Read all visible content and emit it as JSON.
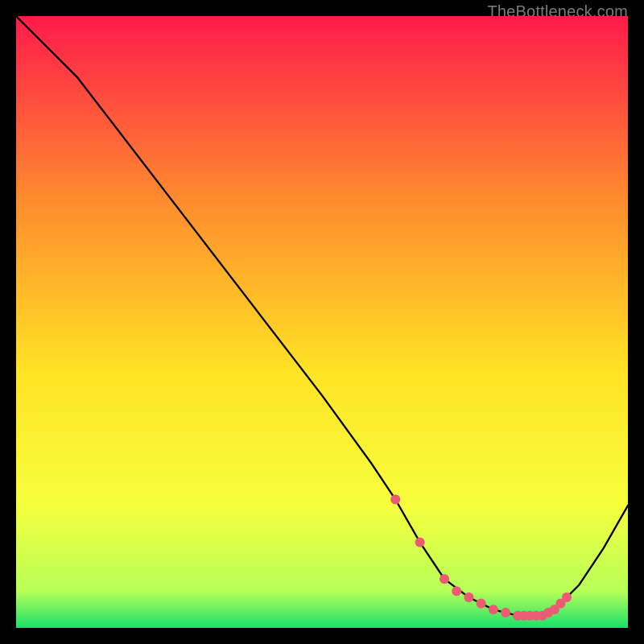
{
  "watermark": "TheBottleneck.com",
  "colors": {
    "black": "#000000",
    "line": "#000000",
    "marker": "#ed5a74",
    "gradient_top": "#ff1a4b",
    "gradient_mid_upper": "#ff8b2e",
    "gradient_mid": "#ffe324",
    "gradient_mid_lower": "#f6ff3c",
    "gradient_low": "#b6ff58",
    "gradient_bottom": "#18e06a"
  },
  "chart_data": {
    "type": "line",
    "title": "",
    "xlabel": "",
    "ylabel": "",
    "xlim": [
      0,
      100
    ],
    "ylim": [
      0,
      100
    ],
    "grid": false,
    "legend": false,
    "series": [
      {
        "name": "curve",
        "x": [
          0,
          6,
          10,
          20,
          30,
          40,
          50,
          58,
          62,
          66,
          70,
          74,
          78,
          82,
          86,
          88,
          92,
          96,
          100
        ],
        "y": [
          100,
          94,
          90,
          77,
          64,
          51,
          38,
          27,
          21,
          14,
          8,
          5,
          3,
          2,
          2,
          3,
          7,
          13,
          20
        ]
      }
    ],
    "markers": {
      "name": "highlight-points",
      "x": [
        62,
        66,
        70,
        72,
        74,
        76,
        78,
        80,
        82,
        83,
        84,
        85,
        86,
        87,
        88,
        89,
        90
      ],
      "y": [
        21,
        14,
        8,
        6,
        5,
        4,
        3,
        2.5,
        2,
        2,
        2,
        2,
        2,
        2.5,
        3,
        4,
        5
      ]
    }
  }
}
